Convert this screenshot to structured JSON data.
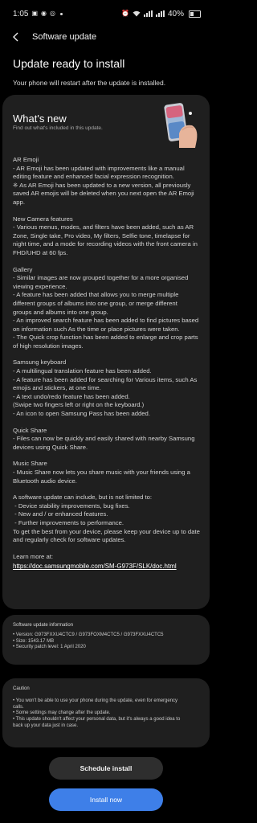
{
  "status_bar": {
    "time": "1:05",
    "battery": "40%",
    "left_icons": [
      "gallery-icon",
      "messenger-icon",
      "whatsapp-icon",
      "settings-icon"
    ],
    "right_icons": [
      "alarm-icon",
      "wifi-icon",
      "signal-icon",
      "signal-icon",
      "battery-icon"
    ]
  },
  "header": {
    "title": "Software update"
  },
  "page": {
    "title": "Update ready to install",
    "subtitle": "Your phone will restart after the update is installed."
  },
  "whats_new": {
    "title": "What's new",
    "subtitle": "Find out what's included in this update.",
    "notes": [
      [
        "AR Emoji",
        "- AR Emoji has been updated with improvements like a manual",
        "editing feature and enhanced facial expression recognition.",
        "※ As AR Emoji has been updated to a new version, all previously",
        "saved AR emojis will be deleted when you next open the AR Emoji",
        "app."
      ],
      [
        "New Camera features",
        "- Various menus, modes, and filters have been added, such as AR",
        "Zone, Single take, Pro video, My filters, Selfie tone, timelapse for",
        "night time, and a mode for recording videos with the front camera in",
        "FHD/UHD at 60 fps."
      ],
      [
        "Gallery",
        "- Similar images are now grouped together for a more organised",
        "viewing experience.",
        "- A feature has been added that allows you to merge multiple",
        "different groups of albums into one group, or merge different",
        "groups and albums into one group.",
        "- An improved search feature has been added to find pictures based",
        "on information such As the time or place pictures were taken.",
        "- The Quick crop function has been added to enlarge and crop parts",
        "of high resolution images."
      ],
      [
        "Samsung keyboard",
        "- A multilingual translation feature has been added.",
        "- A feature has been added for searching for Various items, such As",
        "emojis and stickers, at one time.",
        "- A text undo/redo feature has been added.",
        "(Swipe two fingers left or right on the keyboard.)",
        "- An icon to open Samsung Pass has been added."
      ],
      [
        "Quick Share",
        "- Files can now be quickly and easily shared with nearby Samsung",
        "devices using Quick Share."
      ],
      [
        "Music Share",
        "- Music Share now lets you share music with your friends using a",
        "Bluetooth audio device."
      ],
      [
        "A software update can include, but is not limited to:",
        " - Device stability improvements, bug fixes.",
        " - New and / or enhanced features.",
        " - Further improvements to performance.",
        "To get the best from your device, please keep your device up to date",
        "and regularly check for software updates."
      ]
    ],
    "learn_more_label": "Learn more at:",
    "learn_more_url": "https://doc.samsungmobile.com/SM-G973F/SLK/doc.html"
  },
  "info": {
    "heading": "Software update information",
    "lines": [
      "• Version: G973FXXU4CTC9 / G973FOXM4CTC5 / G973FXXU4CTC5",
      "• Size: 1543.17 MB",
      "• Security patch level: 1 April 2020"
    ]
  },
  "caution": {
    "heading": "Caution",
    "lines": [
      "• You won't be able to use your phone during the update, even for emergency",
      "   calls.",
      "• Some settings may change after the update.",
      "• This update shouldn't affect your personal data, but it's always a good idea to",
      "   back up your data just in case."
    ]
  },
  "buttons": {
    "schedule": "Schedule install",
    "install": "Install now"
  },
  "colors": {
    "accent": "#3e7fe8",
    "card": "#1f1f1f",
    "background": "#000000"
  }
}
